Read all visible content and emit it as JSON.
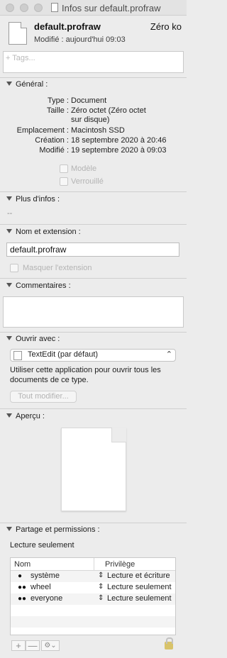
{
  "window": {
    "title": "Infos sur default.profraw"
  },
  "header": {
    "file_name": "default.profraw",
    "file_size": "Zéro ko",
    "modified": "Modifié : aujourd'hui 09:03"
  },
  "tags": {
    "placeholder": "+ Tags..."
  },
  "general": {
    "heading": "Général :",
    "rows": [
      {
        "label": "Type :",
        "value": "Document"
      },
      {
        "label": "Taille :",
        "value": "Zéro octet (Zéro octet",
        "value2": "sur disque)"
      },
      {
        "label": "Emplacement :",
        "value": "Macintosh SSD"
      },
      {
        "label": "Création :",
        "value": "18 septembre 2020 à 20:46"
      },
      {
        "label": "Modifié :",
        "value": "19 septembre 2020 à 09:03"
      }
    ],
    "template_label": "Modèle",
    "locked_label": "Verrouillé"
  },
  "more_info": {
    "heading": "Plus d'infos :",
    "value": "--"
  },
  "name_ext": {
    "heading": "Nom et extension :",
    "value": "default.profraw",
    "hide_ext_label": "Masquer l'extension"
  },
  "comments": {
    "heading": "Commentaires :"
  },
  "open_with": {
    "heading": "Ouvrir avec :",
    "selected": "TextEdit (par défaut)",
    "description_line1": "Utiliser cette application pour ouvrir tous les",
    "description_line2": "documents de ce type.",
    "change_all_label": "Tout modifier..."
  },
  "preview": {
    "heading": "Aperçu :"
  },
  "permissions": {
    "heading": "Partage et permissions :",
    "status": "Lecture seulement",
    "columns": {
      "name": "Nom",
      "privilege": "Privilège"
    },
    "rows": [
      {
        "name": "système",
        "privilege": "Lecture et écriture",
        "icon": "single-user-icon"
      },
      {
        "name": "wheel",
        "privilege": "Lecture seulement",
        "icon": "group-icon"
      },
      {
        "name": "everyone",
        "privilege": "Lecture seulement",
        "icon": "everyone-icon"
      }
    ],
    "add_label": "+",
    "remove_label": "—",
    "action_label": "⚙︎⌄"
  }
}
